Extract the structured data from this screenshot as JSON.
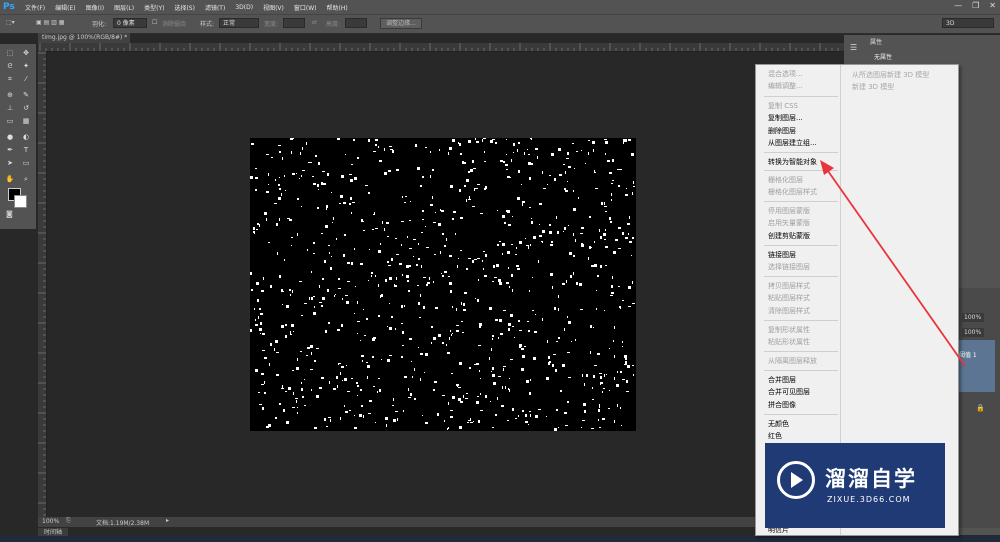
{
  "app": {
    "logo": "Ps"
  },
  "menubar": [
    "文件(F)",
    "编辑(E)",
    "图像(I)",
    "图层(L)",
    "类型(Y)",
    "选择(S)",
    "滤镜(T)",
    "3D(D)",
    "视图(V)",
    "窗口(W)",
    "帮助(H)"
  ],
  "window_controls": {
    "minimize": "—",
    "restore": "❐",
    "close": "✕"
  },
  "options": {
    "feather_label": "羽化:",
    "feather_value": "0 像素",
    "antialias_label": "消除锯齿",
    "style_label": "样式:",
    "style_value": "正常",
    "width_label": "宽度:",
    "height_label": "高度:",
    "refine_button": "调整边缘...",
    "workspace": "3D"
  },
  "document": {
    "tab": "timg.jpg @ 100%(RGB/8#) *"
  },
  "status": {
    "zoom": "100%",
    "doc_info": "文档:1.19M/2.38M"
  },
  "timeline_tab": "时间轴",
  "properties": {
    "title": "属性",
    "subtitle": "无属性"
  },
  "layers": {
    "opacity": "100%",
    "fill": "100%",
    "layer_name": "阈值 1"
  },
  "context_menu": {
    "items": [
      {
        "label": "混合选项...",
        "disabled": true
      },
      {
        "label": "编辑调整...",
        "disabled": true
      },
      {
        "label": "复制 CSS",
        "disabled": true
      },
      {
        "label": "复制图层...",
        "disabled": false
      },
      {
        "label": "删除图层",
        "disabled": false
      },
      {
        "label": "从图层建立组...",
        "disabled": false
      },
      {
        "label": "转换为智能对象",
        "disabled": false
      },
      {
        "label": "栅格化图层",
        "disabled": true
      },
      {
        "label": "栅格化图层样式",
        "disabled": true
      },
      {
        "label": "停用图层蒙版",
        "disabled": true
      },
      {
        "label": "启用矢量蒙版",
        "disabled": true
      },
      {
        "label": "创建剪贴蒙版",
        "disabled": false
      },
      {
        "label": "链接图层",
        "disabled": false
      },
      {
        "label": "选择链接图层",
        "disabled": true
      },
      {
        "label": "拷贝图层样式",
        "disabled": true
      },
      {
        "label": "粘贴图层样式",
        "disabled": true
      },
      {
        "label": "清除图层样式",
        "disabled": true
      },
      {
        "label": "复制形状属性",
        "disabled": true
      },
      {
        "label": "粘贴形状属性",
        "disabled": true
      },
      {
        "label": "从隔离图层释放",
        "disabled": true
      },
      {
        "label": "合并图层",
        "disabled": false
      },
      {
        "label": "合并可见图层",
        "disabled": false
      },
      {
        "label": "拼合图像",
        "disabled": false
      },
      {
        "label": "无颜色",
        "disabled": false
      },
      {
        "label": "红色",
        "disabled": false
      },
      {
        "label": "明信片",
        "disabled": false
      }
    ],
    "column2": [
      "从所选图层新建 3D 模型",
      "新建 3D 模型"
    ]
  },
  "watermark": {
    "title": "溜溜自学",
    "url": "ZIXUE.3D66.COM"
  },
  "colors": {
    "annotation_arrow": "#e8353b",
    "watermark_bg": "#1f3a74",
    "ps_blue": "#31a8ff"
  }
}
